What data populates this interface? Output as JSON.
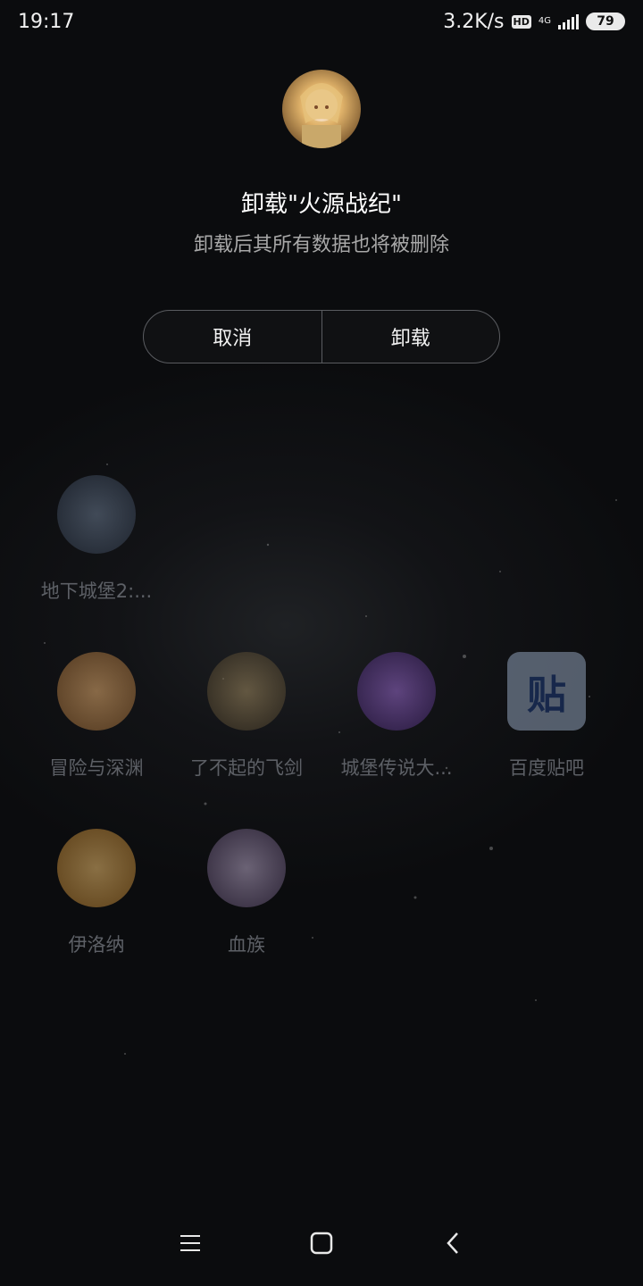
{
  "status_bar": {
    "time": "19:17",
    "speed": "3.2K/s",
    "hd_badge": "HD",
    "network": "4G",
    "battery": "79"
  },
  "dialog": {
    "title": "卸载\"火源战纪\"",
    "subtitle": "卸载后其所有数据也将被删除",
    "cancel_label": "取消",
    "uninstall_label": "卸载"
  },
  "apps": [
    {
      "label": "地下城堡2:...",
      "icon": "dungeon-castle-icon",
      "color": "#3b4a5c"
    },
    {
      "label": "冒险与深渊",
      "icon": "adventure-abyss-icon",
      "color": "#b47a3c"
    },
    {
      "label": "了不起的飞剑",
      "icon": "flying-sword-icon",
      "color": "#6b5a3a"
    },
    {
      "label": "城堡传说大...",
      "icon": "castle-legend-icon",
      "color": "#5a3c8a"
    },
    {
      "label": "百度贴吧",
      "icon": "tieba-icon",
      "color": "#4a5a78"
    },
    {
      "label": "伊洛纳",
      "icon": "elona-icon",
      "color": "#c08a3a"
    },
    {
      "label": "血族",
      "icon": "vampire-icon",
      "color": "#6a5a7a"
    }
  ]
}
